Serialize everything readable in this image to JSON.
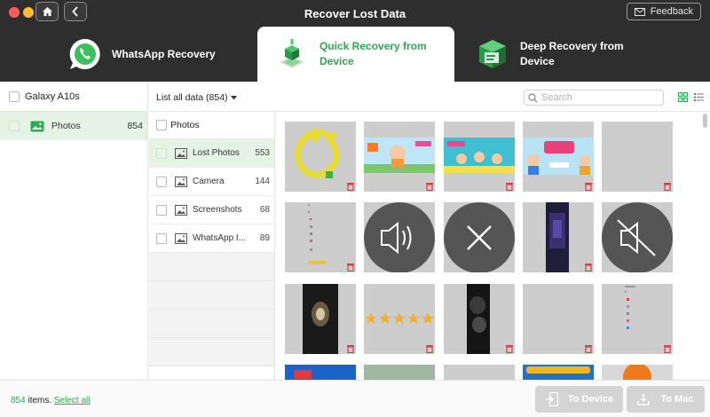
{
  "window": {
    "title": "Recover Lost Data"
  },
  "header": {
    "feedback_label": "Feedback"
  },
  "tabs": [
    {
      "id": "whatsapp",
      "label": "WhatsApp Recovery",
      "active": false
    },
    {
      "id": "quick",
      "label_line1": "Quick Recovery from",
      "label_line2": "Device",
      "active": true
    },
    {
      "id": "deep",
      "label_line1": "Deep Recovery from",
      "label_line2": "Device",
      "active": false
    }
  ],
  "device": {
    "name": "Galaxy A10s",
    "categories": [
      {
        "label": "Photos",
        "count": "854",
        "icon": "photo-icon"
      }
    ]
  },
  "toolbar": {
    "list_label": "List all data (854)",
    "search_placeholder": "Search",
    "views": [
      "grid-view-icon",
      "list-view-icon"
    ]
  },
  "subcategories": {
    "header": "Photos",
    "items": [
      {
        "label": "Lost Photos",
        "count": "553",
        "icon": "image-icon",
        "active": true
      },
      {
        "label": "Camera",
        "count": "144",
        "icon": "image-icon",
        "active": false
      },
      {
        "label": "Screenshots",
        "count": "68",
        "icon": "image-icon",
        "active": false
      },
      {
        "label": "WhatsApp I...",
        "count": "89",
        "icon": "image-icon",
        "active": false
      }
    ]
  },
  "thumbnails": [
    "yellow-shapes-image",
    "kids-cartoon-banner-image",
    "kids-cartoon-banner-image",
    "kids-school-banner-image",
    "blank-image",
    "screenshot-list-image",
    "audio-file-icon",
    "broken-file-icon",
    "dark-phone-screenshot-image",
    "muted-audio-file-icon",
    "dark-photo-image",
    "star-rating-image",
    "dark-photo-image",
    "blank-image",
    "screenshot-list-image",
    "blue-app-image",
    "photo-image",
    "blank-image",
    "game-image",
    "orange-ball-image"
  ],
  "footer": {
    "count": "854",
    "items_text": " items.",
    "select_all_label": "Select all",
    "to_device_label": "To Device",
    "to_mac_label": "To Mac"
  },
  "colors": {
    "accent": "#2fa84f",
    "header": "#2e2e2e",
    "selected_row": "#e4f3e4",
    "thumb_bg": "#cdcdcd",
    "trash": "#e0383a"
  }
}
